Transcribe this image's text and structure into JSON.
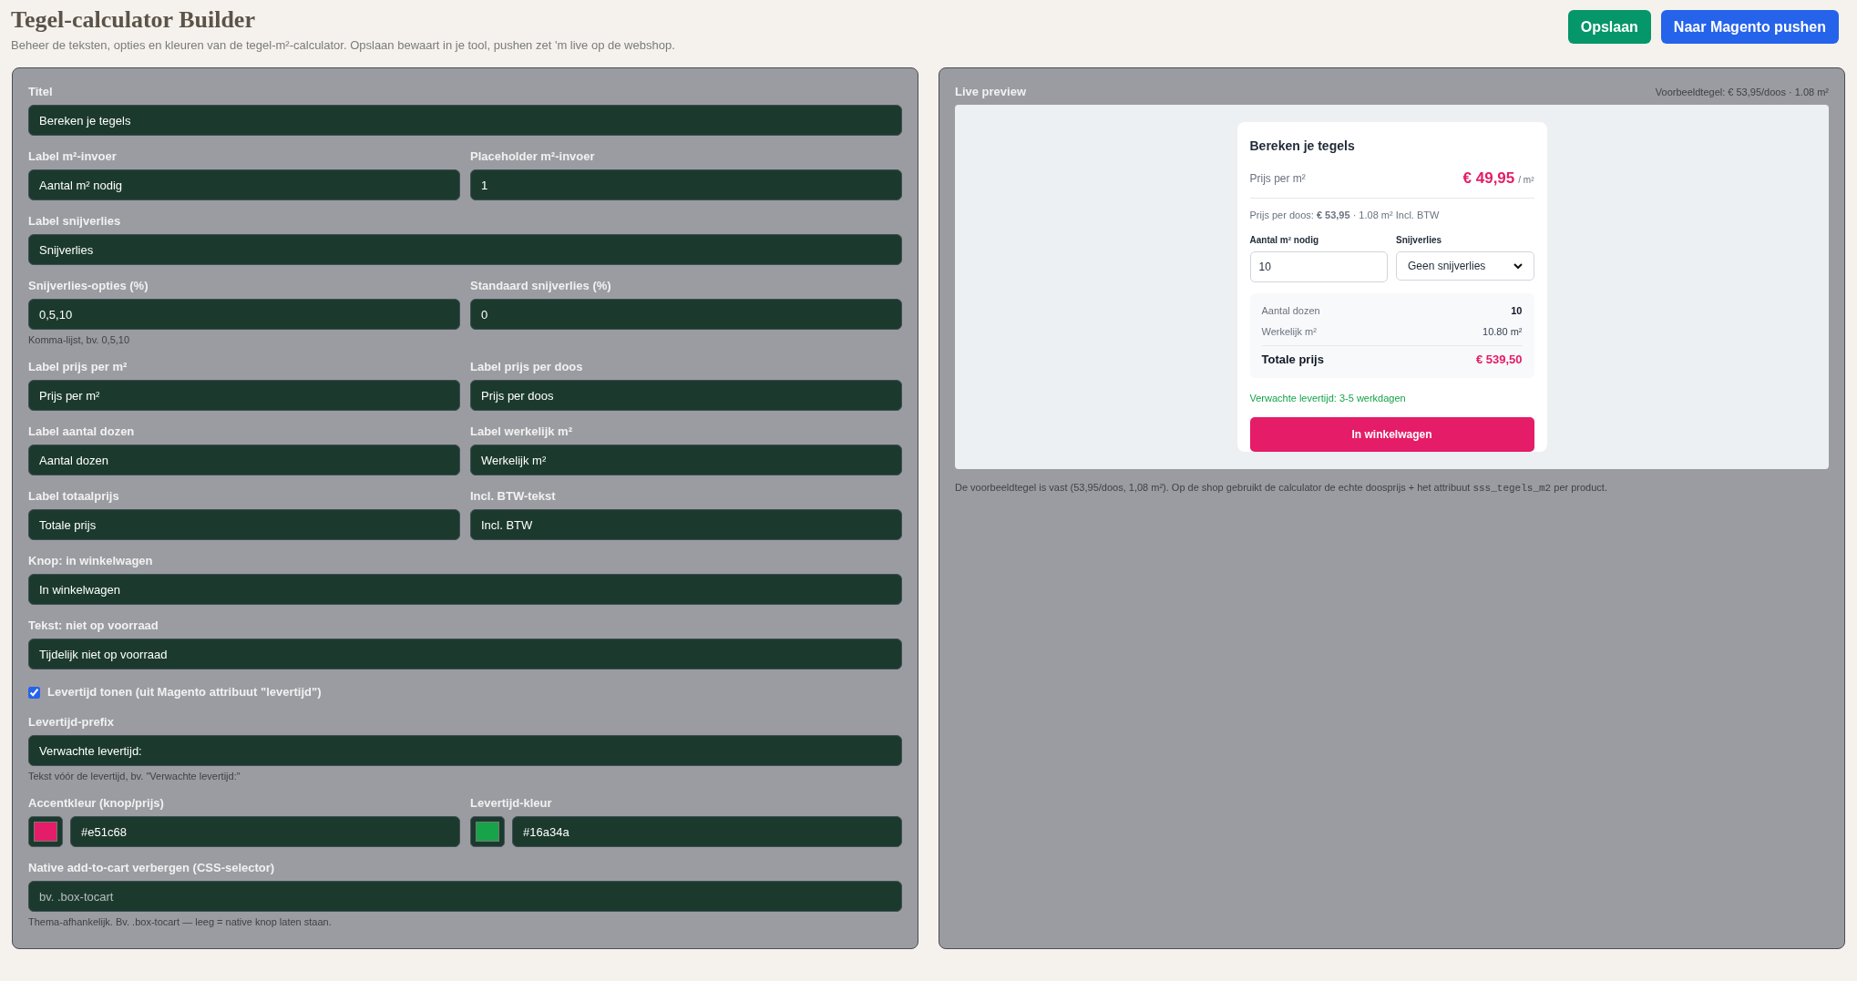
{
  "header": {
    "title": "Tegel-calculator Builder",
    "subtitle": "Beheer de teksten, opties en kleuren van de tegel-m²-calculator. Opslaan bewaart in je tool, pushen zet 'm live op de webshop.",
    "buttons": [
      {
        "label": "Opslaan",
        "kind": "save"
      },
      {
        "label": "Naar Magento pushen",
        "kind": "push"
      }
    ]
  },
  "form": {
    "rows": [
      {
        "fields": [
          {
            "kind": "text",
            "label": "Titel",
            "value": "Bereken je tegels"
          }
        ]
      },
      {
        "fields": [
          {
            "kind": "text",
            "label": "Label m²-invoer",
            "value": "Aantal m² nodig"
          },
          {
            "kind": "text",
            "label": "Placeholder m²-invoer",
            "value": "1"
          }
        ]
      },
      {
        "fields": [
          {
            "kind": "text",
            "label": "Label snijverlies",
            "value": "Snijverlies"
          }
        ]
      },
      {
        "fields": [
          {
            "kind": "text",
            "label": "Snijverlies-opties (%)",
            "value": "0,5,10",
            "help": "Komma-lijst, bv. 0,5,10"
          },
          {
            "kind": "text",
            "label": "Standaard snijverlies (%)",
            "value": "0"
          }
        ]
      },
      {
        "fields": [
          {
            "kind": "text",
            "label": "Label prijs per m²",
            "value": "Prijs per m²"
          },
          {
            "kind": "text",
            "label": "Label prijs per doos",
            "value": "Prijs per doos"
          }
        ]
      },
      {
        "fields": [
          {
            "kind": "text",
            "label": "Label aantal dozen",
            "value": "Aantal dozen"
          },
          {
            "kind": "text",
            "label": "Label werkelijk m²",
            "value": "Werkelijk m²"
          }
        ]
      },
      {
        "fields": [
          {
            "kind": "text",
            "label": "Label totaalprijs",
            "value": "Totale prijs"
          },
          {
            "kind": "text",
            "label": "Incl. BTW-tekst",
            "value": "Incl. BTW"
          }
        ]
      },
      {
        "fields": [
          {
            "kind": "text",
            "label": "Knop: in winkelwagen",
            "value": "In winkelwagen"
          }
        ]
      },
      {
        "fields": [
          {
            "kind": "text",
            "label": "Tekst: niet op voorraad",
            "value": "Tijdelijk niet op voorraad"
          }
        ]
      },
      {
        "fields": [
          {
            "kind": "checkbox",
            "label": "Levertijd tonen (uit Magento attribuut \"levertijd\")",
            "checked": true
          }
        ]
      },
      {
        "fields": [
          {
            "kind": "text",
            "label": "Levertijd-prefix",
            "value": "Verwachte levertijd:",
            "help": "Tekst vóór de levertijd, bv. \"Verwachte levertijd:\""
          }
        ]
      },
      {
        "fields": [
          {
            "kind": "color",
            "label": "Accentkleur (knop/prijs)",
            "value": "#e51c68",
            "color": "#e51c68"
          },
          {
            "kind": "color",
            "label": "Levertijd-kleur",
            "value": "#16a34a",
            "color": "#16a34a"
          }
        ]
      },
      {
        "fields": [
          {
            "kind": "text",
            "label": "Native add-to-cart verbergen (CSS-selector)",
            "placeholder": "bv. .box-tocart",
            "help": "Thema-afhankelijk. Bv. .box-tocart — leeg = native knop laten staan."
          }
        ]
      }
    ]
  },
  "preview": {
    "title": "Live preview",
    "meta": "Voorbeeldtegel: € 53,95/doos · 1.08 m²",
    "card": {
      "title": "Bereken je tegels",
      "price_label": "Prijs per m²",
      "price": "€ 49,95",
      "price_unit": "/ m²",
      "box_line": "Prijs per doos: **€ 53,95** · 1.08 m² Incl. BTW",
      "qty_label": "Aantal m² nodig",
      "qty_value": "10",
      "loss_label": "Snijverlies",
      "loss_value": "Geen snijverlies",
      "summary": [
        {
          "kind": "count",
          "label": "Aantal dozen",
          "value": "10"
        },
        {
          "kind": "plain",
          "label": "Werkelijk m²",
          "value": "10.80 m²"
        },
        {
          "kind": "total",
          "label": "Totale prijs",
          "value": "€ 539,50"
        }
      ],
      "delivery": "Verwachte levertijd: 3-5 werkdagen",
      "button": "In winkelwagen"
    },
    "note_before": "De voorbeeldtegel is vast (53,95/doos, 1,08 m²). Op de shop gebruikt de calculator de echte doosprijs + het attribuut",
    "note_code": "sss_tegels_m2",
    "note_after": "per product."
  }
}
